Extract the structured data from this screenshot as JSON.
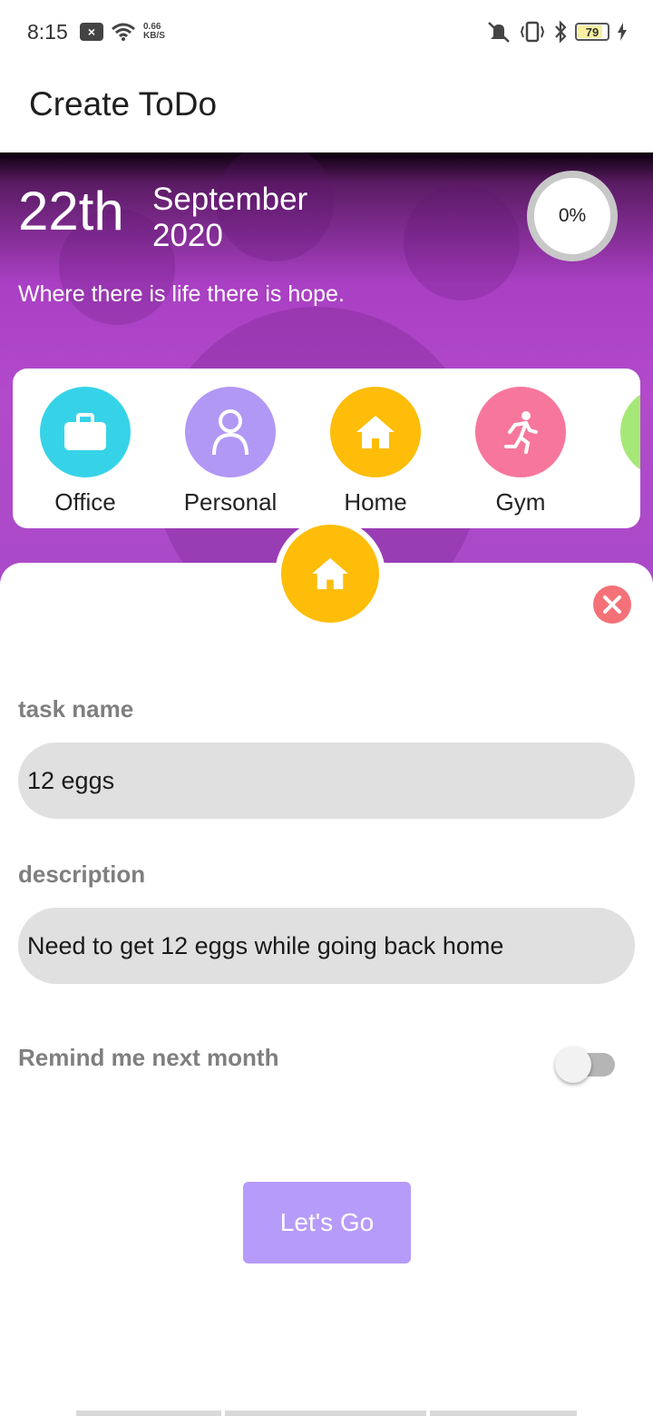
{
  "status_bar": {
    "time": "8:15",
    "net_speed_value": "0.66",
    "net_speed_unit": "KB/S",
    "battery": "79"
  },
  "app_bar": {
    "title": "Create ToDo"
  },
  "hero": {
    "day": "22th",
    "month": "September",
    "year": "2020",
    "quote": "Where there is life there is hope.",
    "progress": "0%"
  },
  "categories": [
    {
      "label": "Office",
      "icon": "briefcase-icon",
      "color": "#36d3e8"
    },
    {
      "label": "Personal",
      "icon": "person-icon",
      "color": "#b198f5"
    },
    {
      "label": "Home",
      "icon": "home-icon",
      "color": "#fdbd08"
    },
    {
      "label": "Gym",
      "icon": "running-icon",
      "color": "#f7779c"
    },
    {
      "label": "",
      "icon": "partial-category-icon",
      "color": "#a6e878"
    }
  ],
  "form": {
    "selected_category_icon": "home-icon",
    "task_name_label": "task name",
    "task_name_value": "12 eggs",
    "description_label": "description",
    "description_value": "Need to get 12 eggs while going back home",
    "remind_label": "Remind me next month",
    "remind_on": false,
    "submit_label": "Let's Go"
  }
}
